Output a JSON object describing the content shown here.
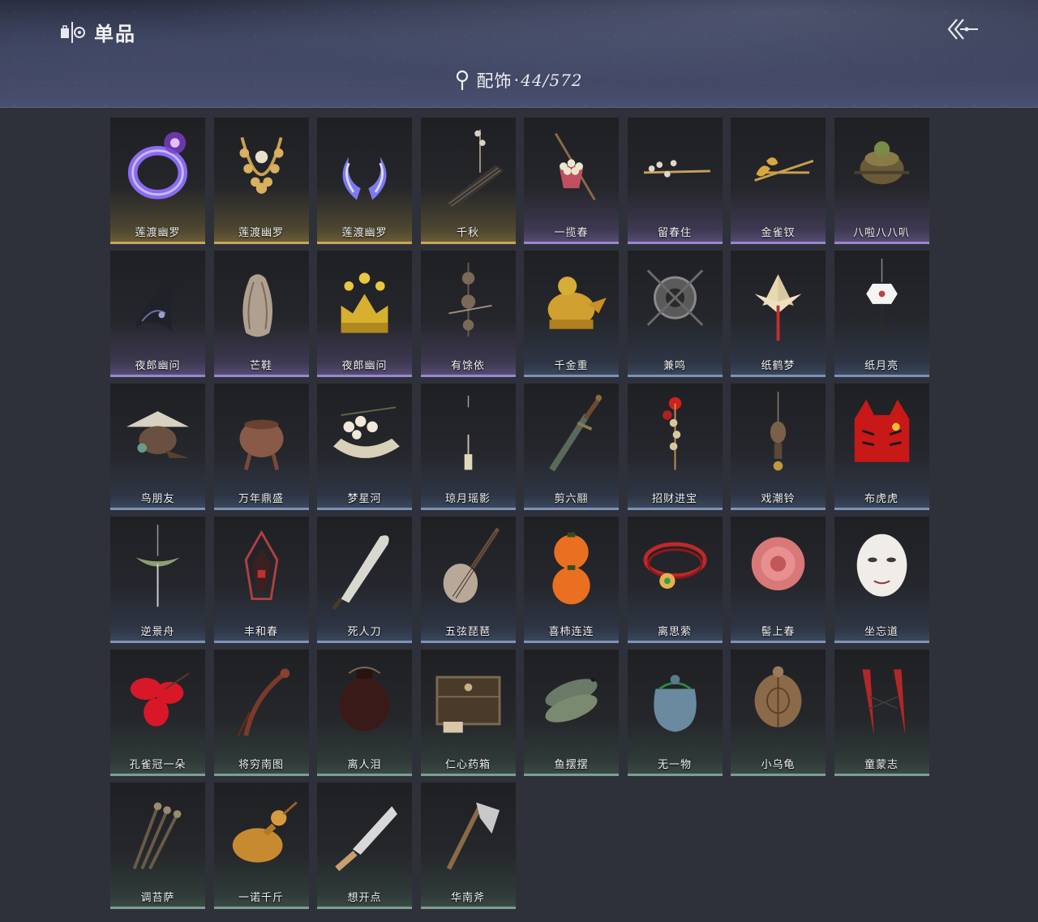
{
  "header": {
    "title": "单品",
    "category_label": "配饰",
    "separator": "·",
    "count": "44/572"
  },
  "colors": {
    "gold": "#c8a65a",
    "purple": "#9a86d0",
    "blue": "#7d92b8",
    "green": "#7e9e92"
  },
  "items": [
    {
      "name": "莲渡幽罗",
      "rarity": "gold",
      "icon": "purple-ring-icon"
    },
    {
      "name": "莲渡幽罗",
      "rarity": "gold",
      "icon": "gold-necklace-icon"
    },
    {
      "name": "莲渡幽罗",
      "rarity": "gold",
      "icon": "purple-horns-icon"
    },
    {
      "name": "千秋",
      "rarity": "gold",
      "icon": "zither-icon"
    },
    {
      "name": "一揽春",
      "rarity": "purple",
      "icon": "flower-basket-icon"
    },
    {
      "name": "留春住",
      "rarity": "purple",
      "icon": "flower-hairpin-icon"
    },
    {
      "name": "金雀钗",
      "rarity": "purple",
      "icon": "gold-hairpin-icon"
    },
    {
      "name": "八啦八八叭",
      "rarity": "purple",
      "icon": "bronze-vessel-icon"
    },
    {
      "name": "夜郎幽问",
      "rarity": "purple",
      "icon": "shadow-wisp-icon"
    },
    {
      "name": "芒鞋",
      "rarity": "purple",
      "icon": "straw-sandal-icon"
    },
    {
      "name": "夜郎幽问",
      "rarity": "purple",
      "icon": "gold-crown-icon"
    },
    {
      "name": "有馀依",
      "rarity": "purple",
      "icon": "bead-ornament-icon"
    },
    {
      "name": "千金重",
      "rarity": "blue",
      "icon": "gold-bird-icon"
    },
    {
      "name": "兼鸣",
      "rarity": "blue",
      "icon": "shield-charm-icon"
    },
    {
      "name": "纸鹤梦",
      "rarity": "blue",
      "icon": "paper-crane-icon"
    },
    {
      "name": "纸月亮",
      "rarity": "blue",
      "icon": "paper-moon-icon"
    },
    {
      "name": "鸟朋友",
      "rarity": "blue",
      "icon": "bird-house-icon"
    },
    {
      "name": "万年鼎盛",
      "rarity": "blue",
      "icon": "tripod-cauldron-icon"
    },
    {
      "name": "梦星河",
      "rarity": "blue",
      "icon": "flower-boat-icon"
    },
    {
      "name": "琼月瑶影",
      "rarity": "blue",
      "icon": "crescent-pendant-icon"
    },
    {
      "name": "剪六翮",
      "rarity": "blue",
      "icon": "dagger-icon"
    },
    {
      "name": "招财进宝",
      "rarity": "blue",
      "icon": "red-charm-icon"
    },
    {
      "name": "戏潮铃",
      "rarity": "blue",
      "icon": "bell-pendant-icon"
    },
    {
      "name": "布虎虎",
      "rarity": "blue",
      "icon": "cloth-tiger-icon"
    },
    {
      "name": "逆景舟",
      "rarity": "blue",
      "icon": "boat-pendant-icon"
    },
    {
      "name": "丰和春",
      "rarity": "blue",
      "icon": "lantern-icon"
    },
    {
      "name": "死人刀",
      "rarity": "blue",
      "icon": "broad-blade-icon"
    },
    {
      "name": "五弦琵琶",
      "rarity": "blue",
      "icon": "pipa-icon"
    },
    {
      "name": "喜柿连连",
      "rarity": "blue",
      "icon": "persimmon-icon"
    },
    {
      "name": "离思萦",
      "rarity": "blue",
      "icon": "red-necklace-icon"
    },
    {
      "name": "髻上春",
      "rarity": "blue",
      "icon": "peony-icon"
    },
    {
      "name": "坐忘道",
      "rarity": "blue",
      "icon": "white-mask-icon"
    },
    {
      "name": "孔雀冠一朵",
      "rarity": "green",
      "icon": "red-flower-icon"
    },
    {
      "name": "将穷南图",
      "rarity": "green",
      "icon": "dragon-pin-icon"
    },
    {
      "name": "离人泪",
      "rarity": "green",
      "icon": "clay-jar-icon"
    },
    {
      "name": "仁心药箱",
      "rarity": "green",
      "icon": "medicine-chest-icon"
    },
    {
      "name": "鱼摆摆",
      "rarity": "green",
      "icon": "fish-icon"
    },
    {
      "name": "无一物",
      "rarity": "green",
      "icon": "cloth-pouch-icon"
    },
    {
      "name": "小乌龟",
      "rarity": "green",
      "icon": "turtle-icon"
    },
    {
      "name": "童蒙志",
      "rarity": "green",
      "icon": "red-tassel-icon"
    },
    {
      "name": "调苔萨",
      "rarity": "green",
      "icon": "arrow-bundle-icon"
    },
    {
      "name": "一诺千斤",
      "rarity": "green",
      "icon": "roast-duck-icon"
    },
    {
      "name": "想开点",
      "rarity": "green",
      "icon": "kitchen-knife-icon"
    },
    {
      "name": "华南斧",
      "rarity": "green",
      "icon": "axe-icon"
    }
  ]
}
